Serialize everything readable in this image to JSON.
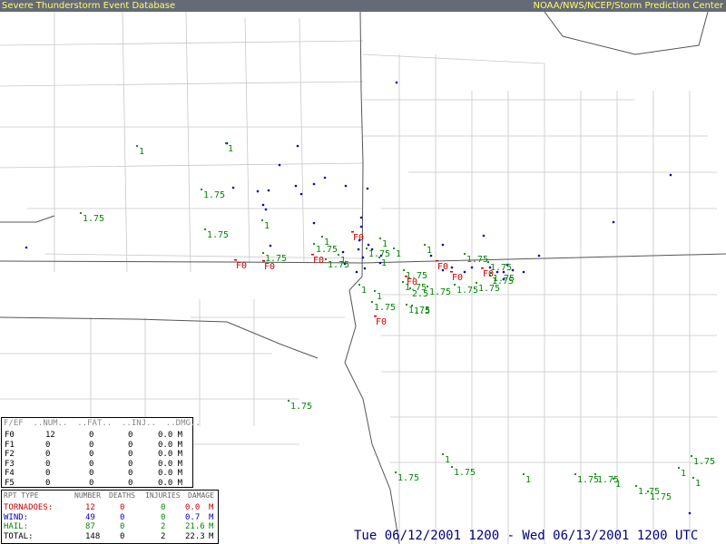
{
  "header": {
    "title": "Severe Thunderstorm Event Database",
    "agency": "NOAA/NWS/NCEP/Storm Prediction Center"
  },
  "colors": {
    "tornado": "#cc0000",
    "wind": "#0000cc",
    "hail": "#008800",
    "header_bg": "#666a77",
    "header_text": "#ffff66"
  },
  "map": {
    "hail_labels": [
      {
        "t": "1"
      },
      {
        "t": "1"
      },
      {
        "t": "1.75"
      },
      {
        "t": "1.75"
      },
      {
        "t": "1.75"
      },
      {
        "t": "1"
      },
      {
        "t": "1"
      },
      {
        "t": "1.75"
      },
      {
        "t": "1"
      },
      {
        "t": "1.75"
      },
      {
        "t": "1.75"
      },
      {
        "t": "1"
      },
      {
        "t": "1"
      },
      {
        "t": "1"
      },
      {
        "t": "1.75"
      },
      {
        "t": "1.75"
      },
      {
        "t": "1.75"
      },
      {
        "t": "1.75"
      },
      {
        "t": "2.5"
      },
      {
        "t": "1.75"
      },
      {
        "t": "1.5"
      },
      {
        "t": "1.75"
      },
      {
        "t": "1.75"
      },
      {
        "t": "1.75"
      },
      {
        "t": "1.75"
      },
      {
        "t": "1.75"
      },
      {
        "t": "1.75"
      },
      {
        "t": "1"
      },
      {
        "t": "1.75"
      },
      {
        "t": "1.75"
      },
      {
        "t": "1"
      },
      {
        "t": "1.75"
      },
      {
        "t": "1.75"
      },
      {
        "t": "1"
      },
      {
        "t": "1"
      },
      {
        "t": "1.75"
      },
      {
        "t": "1"
      },
      {
        "t": "1.75"
      },
      {
        "t": "1.75"
      },
      {
        "t": "1"
      },
      {
        "t": "1"
      },
      {
        "t": "1.75"
      },
      {
        "t": "1"
      },
      {
        "t": "1.75"
      }
    ],
    "tornado_labels": [
      {
        "t": "F0"
      },
      {
        "t": "F0"
      },
      {
        "t": "F0"
      },
      {
        "t": "F0"
      },
      {
        "t": "F0"
      },
      {
        "t": "F0"
      },
      {
        "t": "F0"
      },
      {
        "t": "F0"
      },
      {
        "t": "F0"
      }
    ],
    "wind_reports": 49
  },
  "fscale_table": {
    "header": "F/EF  ..NUM..  ..FAT..  ..INJ..  ..DMG..",
    "rows": [
      {
        "scale": "F0",
        "num": "12",
        "fat": "0",
        "inj": "0",
        "dmg": "0.0 M"
      },
      {
        "scale": "F1",
        "num": "0",
        "fat": "0",
        "inj": "0",
        "dmg": "0.0 M"
      },
      {
        "scale": "F2",
        "num": "0",
        "fat": "0",
        "inj": "0",
        "dmg": "0.0 M"
      },
      {
        "scale": "F3",
        "num": "0",
        "fat": "0",
        "inj": "0",
        "dmg": "0.0 M"
      },
      {
        "scale": "F4",
        "num": "0",
        "fat": "0",
        "inj": "0",
        "dmg": "0.0 M"
      },
      {
        "scale": "F5",
        "num": "0",
        "fat": "0",
        "inj": "0",
        "dmg": "0.0 M"
      }
    ]
  },
  "report_table": {
    "headers": {
      "type": "RPT TYPE",
      "number": "NUMBER",
      "deaths": "DEATHS",
      "injuries": "INJURIES",
      "damage": "DAMAGE"
    },
    "rows": [
      {
        "type": "TORNADOES:",
        "number": "12",
        "deaths": "0",
        "injuries": "0",
        "damage": "0.0",
        "unit": "M",
        "color": "#cc0000"
      },
      {
        "type": "WIND:",
        "number": "49",
        "deaths": "0",
        "injuries": "0",
        "damage": "0.7",
        "unit": "M",
        "color": "#0000cc"
      },
      {
        "type": "HAIL:",
        "number": "87",
        "deaths": "0",
        "injuries": "2",
        "damage": "21.6",
        "unit": "M",
        "color": "#008800"
      },
      {
        "type": "TOTAL:",
        "number": "148",
        "deaths": "0",
        "injuries": "2",
        "damage": "22.3",
        "unit": "M",
        "color": "#000000"
      }
    ]
  },
  "date_range": "Tue 06/12/2001 1200 - Wed 06/13/2001 1200 UTC"
}
